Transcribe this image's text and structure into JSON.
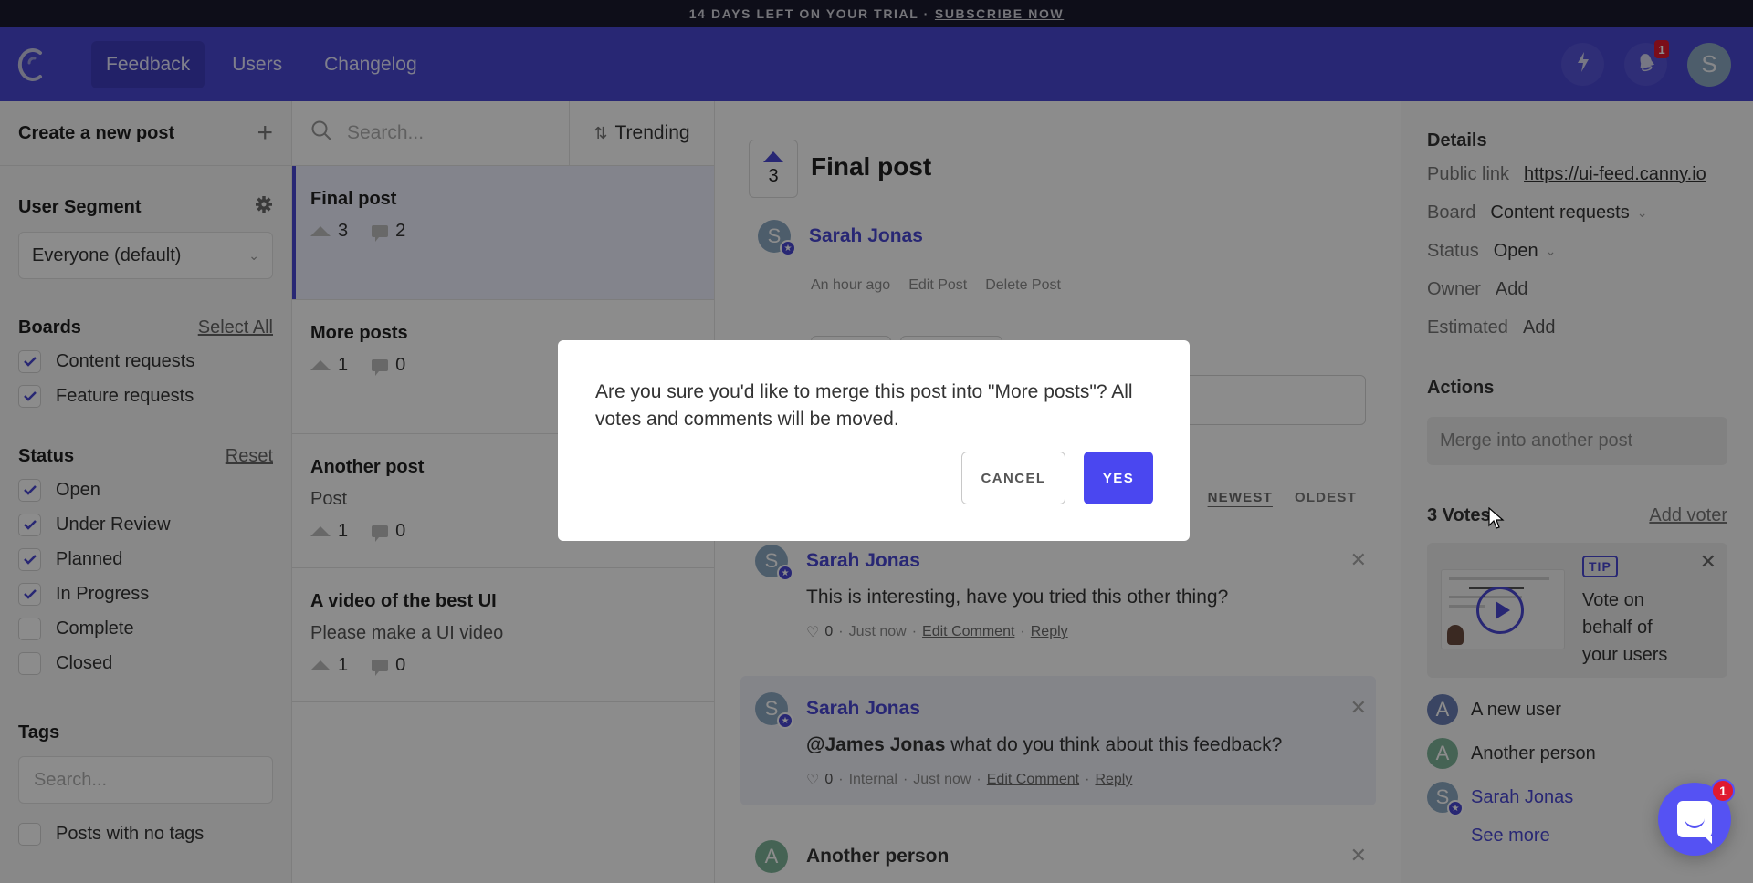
{
  "banner": {
    "text": "14 DAYS LEFT ON YOUR TRIAL ·",
    "link": "SUBSCRIBE NOW"
  },
  "nav": {
    "tabs": [
      {
        "label": "Feedback",
        "active": true
      },
      {
        "label": "Users",
        "active": false
      },
      {
        "label": "Changelog",
        "active": false
      }
    ],
    "notification_count": "1",
    "avatar_initial": "S"
  },
  "filters": {
    "create_post": "Create a new post",
    "user_segment": {
      "title": "User Segment",
      "selected": "Everyone (default)"
    },
    "boards": {
      "title": "Boards",
      "action": "Select All",
      "items": [
        {
          "label": "Content requests",
          "checked": true
        },
        {
          "label": "Feature requests",
          "checked": true
        }
      ]
    },
    "status": {
      "title": "Status",
      "action": "Reset",
      "items": [
        {
          "label": "Open",
          "checked": true
        },
        {
          "label": "Under Review",
          "checked": true
        },
        {
          "label": "Planned",
          "checked": true
        },
        {
          "label": "In Progress",
          "checked": true
        },
        {
          "label": "Complete",
          "checked": false
        },
        {
          "label": "Closed",
          "checked": false
        }
      ]
    },
    "tags": {
      "title": "Tags",
      "placeholder": "Search...",
      "no_tags_label": "Posts with no tags",
      "no_tags_checked": false
    }
  },
  "posts": {
    "search_placeholder": "Search...",
    "sort": "Trending",
    "items": [
      {
        "title": "Final post",
        "description": "",
        "votes": "3",
        "comments": "2",
        "selected": true
      },
      {
        "title": "More posts",
        "description": "",
        "votes": "1",
        "comments": "0",
        "selected": false
      },
      {
        "title": "Another post",
        "description": "Post",
        "votes": "1",
        "comments": "0",
        "selected": false
      },
      {
        "title": "A video of the best UI",
        "description": "Please make a UI video",
        "votes": "1",
        "comments": "0",
        "selected": false
      }
    ]
  },
  "detail": {
    "votes": "3",
    "title": "Final post",
    "author": "Sarah Jonas",
    "author_initial": "S",
    "time": "An hour ago",
    "edit": "Edit Post",
    "delete": "Delete Post",
    "sort_tabs": [
      "NEWEST",
      "OLDEST"
    ],
    "comments": [
      {
        "author": "Sarah Jonas",
        "initial": "S",
        "admin": true,
        "internal": false,
        "mention": "",
        "text": "This is interesting, have you tried this other thing?",
        "likes": "0",
        "tag": "",
        "time": "Just now",
        "edit": "Edit Comment",
        "reply": "Reply"
      },
      {
        "author": "Sarah Jonas",
        "initial": "S",
        "admin": true,
        "internal": true,
        "mention": "@James Jonas",
        "text": " what do you think about this feedback?",
        "likes": "0",
        "tag": "Internal",
        "time": "Just now",
        "edit": "Edit Comment",
        "reply": "Reply"
      },
      {
        "author": "Another person",
        "initial": "A",
        "admin": false,
        "internal": false
      }
    ]
  },
  "side": {
    "details_title": "Details",
    "public_link_label": "Public link",
    "public_link": "https://ui-feed.canny.io",
    "board_label": "Board",
    "board_value": "Content requests",
    "status_label": "Status",
    "status_value": "Open",
    "owner_label": "Owner",
    "owner_value": "Add",
    "estimated_label": "Estimated",
    "estimated_value": "Add",
    "actions_title": "Actions",
    "merge_button": "Merge into another post",
    "votes_title": "3 Votes",
    "add_voter": "Add voter",
    "tip": {
      "badge": "TIP",
      "text": "Vote on behalf of your users"
    },
    "voters": [
      {
        "name": "A new user",
        "initial": "A",
        "color": "#6b7fb5",
        "admin": false
      },
      {
        "name": "Another person",
        "initial": "A",
        "color": "#7fb59a",
        "admin": false
      },
      {
        "name": "Sarah Jonas",
        "initial": "S",
        "color": "#8ca9c4",
        "admin": true
      }
    ],
    "see_more": "See more"
  },
  "chat": {
    "badge": "1"
  },
  "modal": {
    "message": "Are you sure you'd like to merge this post into \"More posts\"? All votes and comments will be moved.",
    "cancel": "CANCEL",
    "confirm": "YES"
  },
  "colors": {
    "brand": "#4a47d4",
    "confirm": "#4a47f0",
    "badge": "#e0192f"
  }
}
